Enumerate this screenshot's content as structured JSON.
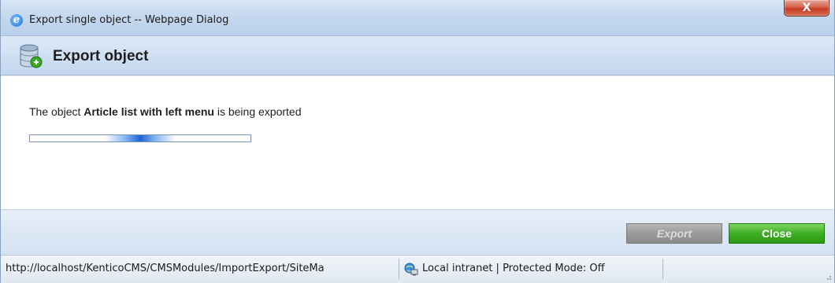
{
  "window": {
    "title": "Export single object -- Webpage Dialog",
    "close_glyph": "X"
  },
  "header": {
    "title": "Export object",
    "icon": "database-icon"
  },
  "content": {
    "message_prefix": "The object ",
    "object_name": "Article list with left menu",
    "message_suffix": " is being exported",
    "progress": "indeterminate"
  },
  "footer": {
    "export_label": "Export",
    "close_label": "Close"
  },
  "statusbar": {
    "url": "http://localhost/KenticoCMS/CMSModules/ImportExport/SiteMa",
    "zone": "Local intranet | Protected Mode: Off"
  },
  "colors": {
    "close_button": "#3fae25",
    "export_button_disabled": "#9a9a9a",
    "progress_accent": "#1b62d4",
    "window_close": "#c23a21"
  }
}
